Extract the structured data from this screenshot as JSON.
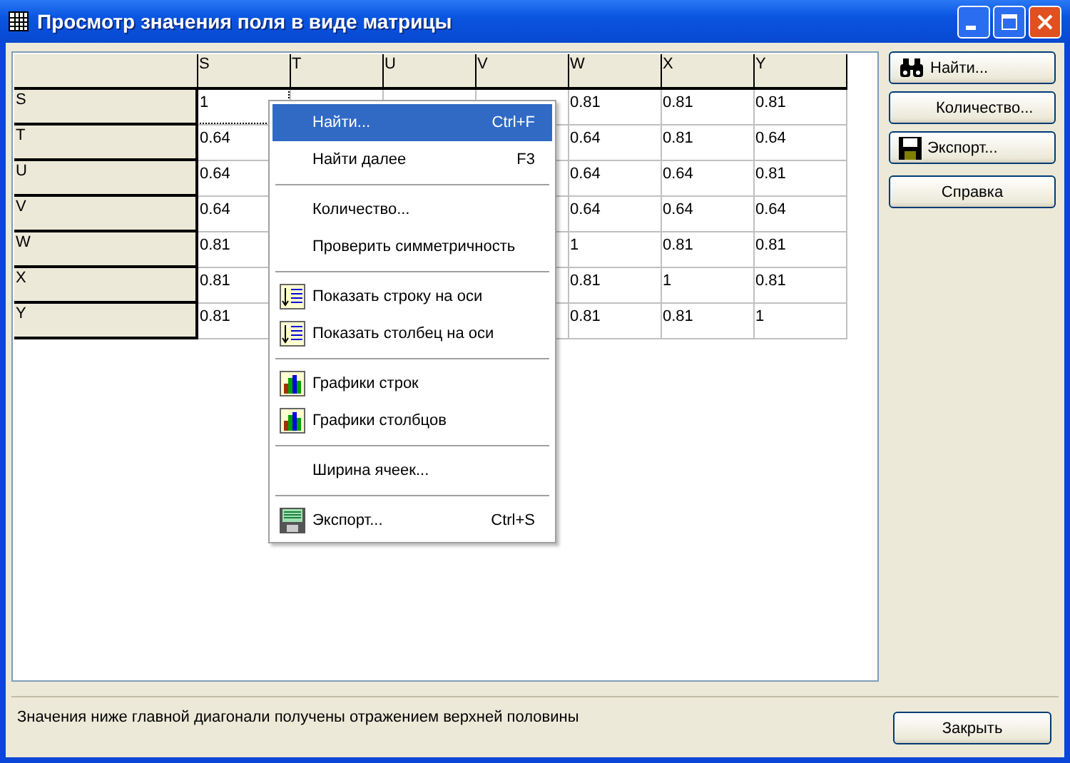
{
  "window": {
    "title": "Просмотр значения поля в виде матрицы"
  },
  "table": {
    "columns": [
      "S",
      "T",
      "U",
      "V",
      "W",
      "X",
      "Y"
    ],
    "rows": [
      {
        "header": "S",
        "cells": [
          {
            "value": "1",
            "focused": true
          },
          null,
          null,
          null,
          {
            "value": "0.81",
            "focused": false
          },
          {
            "value": "0.81",
            "focused": false
          },
          {
            "value": "0.81",
            "focused": false
          }
        ]
      },
      {
        "header": "T",
        "cells": [
          {
            "value": "0.64",
            "focused": false
          },
          null,
          null,
          null,
          {
            "value": "0.64",
            "focused": false
          },
          {
            "value": "0.81",
            "focused": false
          },
          {
            "value": "0.64",
            "focused": false
          }
        ]
      },
      {
        "header": "U",
        "cells": [
          {
            "value": "0.64",
            "focused": false
          },
          null,
          null,
          null,
          {
            "value": "0.64",
            "focused": false
          },
          {
            "value": "0.64",
            "focused": false
          },
          {
            "value": "0.81",
            "focused": false
          }
        ]
      },
      {
        "header": "V",
        "cells": [
          {
            "value": "0.64",
            "focused": false
          },
          null,
          null,
          null,
          {
            "value": "0.64",
            "focused": false
          },
          {
            "value": "0.64",
            "focused": false
          },
          {
            "value": "0.64",
            "focused": false
          }
        ]
      },
      {
        "header": "W",
        "cells": [
          {
            "value": "0.81",
            "focused": false
          },
          null,
          null,
          null,
          {
            "value": "1",
            "focused": false
          },
          {
            "value": "0.81",
            "focused": false
          },
          {
            "value": "0.81",
            "focused": false
          }
        ]
      },
      {
        "header": "X",
        "cells": [
          {
            "value": "0.81",
            "focused": false
          },
          null,
          null,
          null,
          {
            "value": "0.81",
            "focused": false
          },
          {
            "value": "1",
            "focused": false
          },
          {
            "value": "0.81",
            "focused": false
          }
        ]
      },
      {
        "header": "Y",
        "cells": [
          {
            "value": "0.81",
            "focused": false
          },
          null,
          null,
          null,
          {
            "value": "0.81",
            "focused": false
          },
          {
            "value": "0.81",
            "focused": false
          },
          {
            "value": "1",
            "focused": false
          }
        ]
      }
    ]
  },
  "context_menu": [
    {
      "kind": "plain",
      "label": "Найти...",
      "shortcut": "Ctrl+F",
      "selected": true
    },
    {
      "kind": "plain",
      "label": "Найти далее",
      "shortcut": "F3",
      "selected": false
    },
    {
      "kind": "separator"
    },
    {
      "kind": "plain",
      "label": "Количество...",
      "selected": false
    },
    {
      "kind": "plain",
      "label": "Проверить симметричность",
      "selected": false
    },
    {
      "kind": "separator"
    },
    {
      "kind": "axis",
      "label": "Показать строку на оси",
      "selected": false
    },
    {
      "kind": "axis",
      "label": "Показать столбец на оси",
      "selected": false
    },
    {
      "kind": "separator"
    },
    {
      "kind": "chart",
      "label": "Графики строк",
      "selected": false
    },
    {
      "kind": "chart",
      "label": "Графики столбцов",
      "selected": false
    },
    {
      "kind": "separator"
    },
    {
      "kind": "plain",
      "label": "Ширина ячеек...",
      "selected": false
    },
    {
      "kind": "separator"
    },
    {
      "kind": "export",
      "label": "Экспорт...",
      "shortcut": "Ctrl+S",
      "selected": false
    }
  ],
  "side_buttons": [
    {
      "kind": "find",
      "label": "Найти..."
    },
    {
      "kind": "plain",
      "label": "Количество..."
    },
    {
      "kind": "export",
      "label": "Экспорт..."
    },
    {
      "kind": "help",
      "label": "Справка"
    }
  ],
  "status_text": "Значения ниже главной диагонали получены отражением верхней половины",
  "close_button": "Закрыть"
}
